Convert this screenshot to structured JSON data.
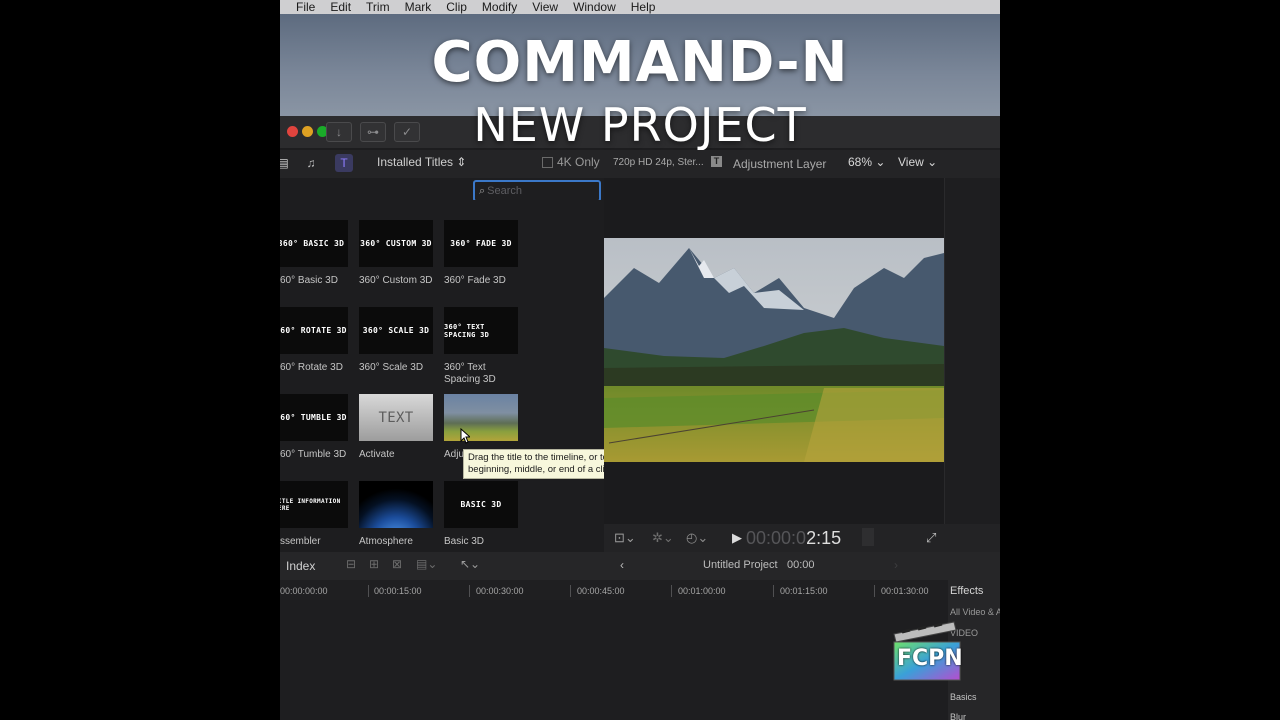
{
  "menu": [
    "File",
    "Edit",
    "Trim",
    "Mark",
    "Clip",
    "Modify",
    "View",
    "Window",
    "Help"
  ],
  "overlay": {
    "line1": "COMMAND-N",
    "line2": "NEW PROJECT"
  },
  "browser": {
    "dropdown": "Installed Titles ⇕",
    "fourk": "4K Only",
    "search_placeholder": "Search",
    "items": [
      {
        "thumb": "360° BASIC 3D",
        "label": "60° Basic 3D"
      },
      {
        "thumb": "360° CUSTOM 3D",
        "label": "360° Custom 3D"
      },
      {
        "thumb": "360° FADE 3D",
        "label": "360° Fade 3D"
      },
      {
        "thumb": "360° ROTATE 3D",
        "label": "60° Rotate 3D"
      },
      {
        "thumb": "360° SCALE 3D",
        "label": "360° Scale 3D"
      },
      {
        "thumb": "360° TEXT SPACING 3D",
        "label": "360° Text Spacing 3D"
      },
      {
        "thumb": "360° TUMBLE 3D",
        "label": "60° Tumble 3D"
      },
      {
        "thumb": "TEXT",
        "label": "Activate"
      },
      {
        "thumb": "",
        "label": "Adju"
      },
      {
        "thumb": "TITLE INFORMATION HERE",
        "label": "ssembler"
      },
      {
        "thumb": "",
        "label": "Atmosphere"
      },
      {
        "thumb": "BASIC 3D",
        "label": "Basic 3D"
      }
    ],
    "tooltip": "Drag the title to the timeline, or to the beginning, middle, or end of a clip"
  },
  "viewer": {
    "format": "720p HD 24p, Ster...",
    "clip": "Adjustment Layer",
    "zoom": "68% ⌄",
    "view": "View ⌄",
    "timecode_dim": "00:00:0",
    "timecode": "2:15"
  },
  "timeline": {
    "index": "Index",
    "project": "Untitled Project",
    "duration": "00:00",
    "ruler": [
      "00:00:00:00",
      "00:00:15:00",
      "00:00:30:00",
      "00:00:45:00",
      "00:01:00:00",
      "00:01:15:00",
      "00:01:30:00"
    ]
  },
  "effects": {
    "title": "Effects",
    "items": [
      "All Video & A",
      "VIDEO",
      "Basics",
      "Blur"
    ]
  },
  "logo_text": "FCPN"
}
